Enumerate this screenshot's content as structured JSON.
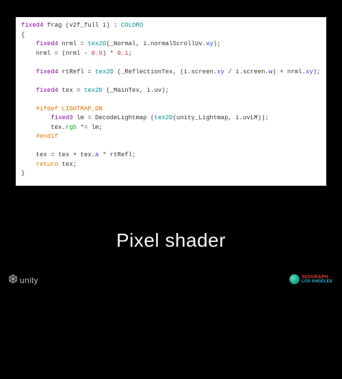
{
  "slide": {
    "title": "Pixel shader"
  },
  "code": {
    "sig_kw": "fixed4",
    "sig_rest": " frag (v2f_full i) : ",
    "sig_color": "COLORO",
    "l2a": "fixed4",
    "l2b": " nrml = ",
    "l2c": "tex2D",
    "l2d": "(_Normal, i.normalScrollUv.",
    "l2e": "xy",
    "l2f": ");",
    "l3a": "nrml = (nrml - ",
    "l3b": "0.5",
    "l3c": ") * ",
    "l3d": "0.1",
    "l3e": ";",
    "l4a": "fixed4",
    "l4b": " rtRefl = ",
    "l4c": "tex2D",
    "l4d": " (_ReflectionTex, (i.screen.",
    "l4e": "xy",
    "l4f": " / i.screen.",
    "l4g": "w",
    "l4h": ") + nrml.",
    "l4i": "xy",
    "l4j": ");",
    "l5a": "fixed4",
    "l5b": " tex = ",
    "l5c": "tex2D",
    "l5d": " (_MainTex, i.uv);",
    "l6": "#ifdef LIGHTMAP_ON",
    "l7a": "fixed3",
    "l7b": " lm = DecodeLightmap (",
    "l7c": "tex2D",
    "l7d": "(unity_Lightmap, i.uvLM));",
    "l8a": "tex.",
    "l8b": "rgb",
    "l8c": " *= lm;",
    "l9": "#endif",
    "l10a": "tex = tex + tex.",
    "l10b": "a",
    "l10c": " * rtRefl;",
    "l11a": "return",
    "l11b": " tex;"
  },
  "logos": {
    "unity": "unity",
    "siggraph_line1": "SIGGRAPH",
    "siggraph_line2": "LOS ANGELES"
  }
}
